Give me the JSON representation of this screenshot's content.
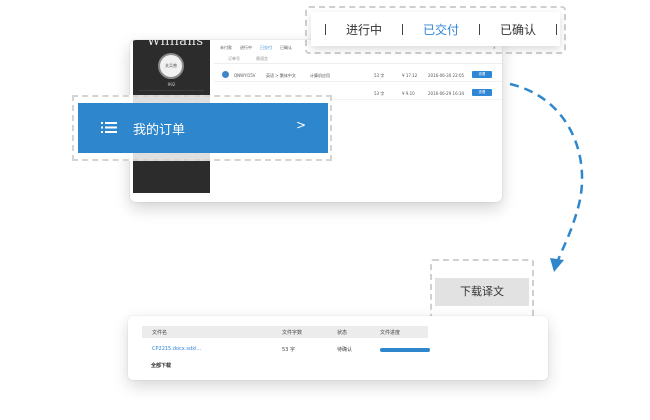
{
  "top_window": {
    "sidebar": {
      "brand": "Willians",
      "avatar_text": "关兵兽",
      "username": "992"
    },
    "breadcrumbs": [
      {
        "label": "未付款",
        "active": false
      },
      {
        "label": "进行中",
        "active": false
      },
      {
        "label": "已交付",
        "active": true
      },
      {
        "label": "已确认",
        "active": false
      }
    ],
    "close_label": "×",
    "subtabs": [
      "订单号",
      "原语言"
    ],
    "orders": [
      {
        "id": "QNWYI15V",
        "lang": "英语 > 繁体中文",
        "type": "计算机应用",
        "words": "53 字",
        "price": "¥ 17.12",
        "time": "2016-06-30 22:05",
        "action": "查看"
      },
      {
        "id": "",
        "lang": "",
        "type": "",
        "words": "53 字",
        "price": "¥ 9.10",
        "time": "2016-06-29 16:34",
        "action": "查看"
      }
    ]
  },
  "status_tabs": {
    "items": [
      {
        "label": "进行中",
        "active": false
      },
      {
        "label": "已交付",
        "active": true
      },
      {
        "label": "已确认",
        "active": false
      }
    ]
  },
  "menu": {
    "label": "我的订单",
    "chevron": ">",
    "icon": "list-icon",
    "color": "#2e87cc"
  },
  "download_panel": {
    "title": "下载译文",
    "icon": "download-icon"
  },
  "file_window": {
    "headers": [
      "文件名",
      "文件字数",
      "状态",
      "文件进度"
    ],
    "row": {
      "name": "CP2215.docx.sdxl...",
      "words": "53 字",
      "status": "待确认"
    },
    "download_all": "全部下载"
  },
  "colors": {
    "accent": "#2f86d4",
    "menu_blue": "#2e87cc",
    "sidebar_dark": "#2c2c2c"
  }
}
